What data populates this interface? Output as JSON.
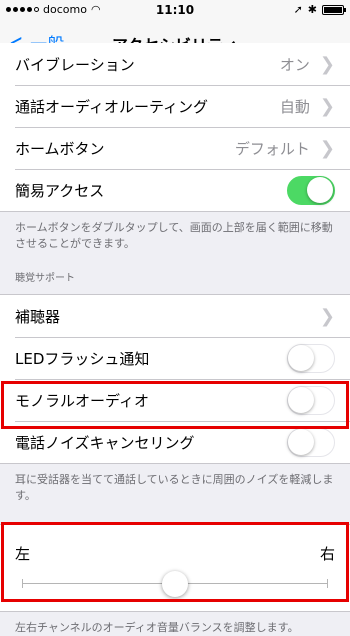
{
  "status_bar": {
    "carrier": "docomo",
    "time": "11:10"
  },
  "nav": {
    "back_label": "一般",
    "title": "アクセシビリティ"
  },
  "rows_top": [
    {
      "label": "バイブレーション",
      "value": "オン"
    },
    {
      "label": "通話オーディオルーティング",
      "value": "自動"
    },
    {
      "label": "ホームボタン",
      "value": "デフォルト"
    }
  ],
  "reachability": {
    "label": "簡易アクセス",
    "on": true
  },
  "reachability_footer": "ホームボタンをダブルタップして、画面の上部を届く範囲に移動させることができます。",
  "hearing_header": "聴覚サポート",
  "hearing": {
    "hearing_aids": "補聴器",
    "led_flash": "LEDフラッシュ通知",
    "mono_audio": "モノラルオーディオ",
    "noise_cancel": "電話ノイズキャンセリング"
  },
  "toggles": {
    "led_flash": false,
    "mono_audio": false,
    "noise_cancel": false
  },
  "noise_footer": "耳に受話器を当てて通話しているときに周囲のノイズを軽減します。",
  "balance": {
    "left_label": "左",
    "right_label": "右",
    "value_fraction": 0.5
  },
  "balance_footer": "左右チャンネルのオーディオ音量バランスを調整します。",
  "colors": {
    "accent": "#007aff",
    "toggle_on": "#4cd964",
    "highlight": "#e60000"
  }
}
